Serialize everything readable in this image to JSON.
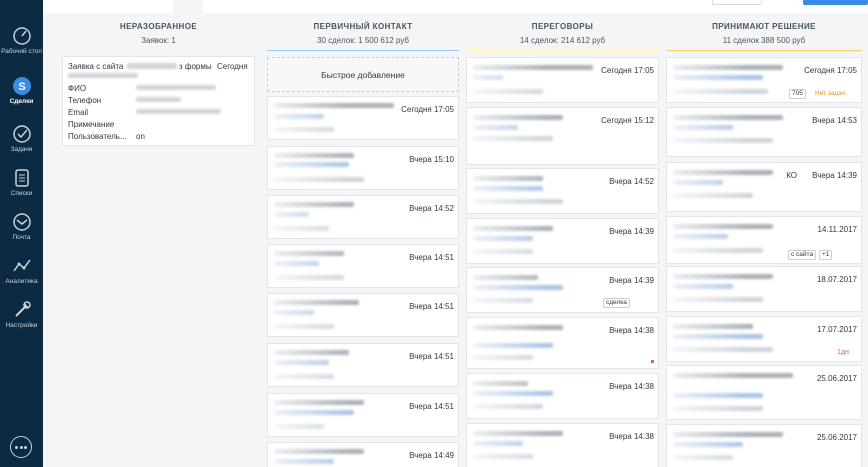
{
  "nav": {
    "items": [
      {
        "label": "Рабочий стол",
        "icon": "dashboard-icon"
      },
      {
        "label": "Сделки",
        "icon": "deals-icon",
        "active": true
      },
      {
        "label": "Задачи",
        "icon": "tasks-icon"
      },
      {
        "label": "Списки",
        "icon": "lists-icon"
      },
      {
        "label": "Почта",
        "icon": "mail-icon"
      },
      {
        "label": "Аналитика",
        "icon": "analytics-icon"
      },
      {
        "label": "Настройки",
        "icon": "settings-icon"
      }
    ],
    "chat_icon": "chat-icon",
    "colors": {
      "background": "#0c2a41",
      "active": "#ffffff"
    }
  },
  "columns": [
    {
      "title": "НЕРАЗОБРАННОЕ",
      "count": "Заявок: 1",
      "accent": "#b4bac0"
    },
    {
      "title": "ПЕРВИЧНЫЙ КОНТАКТ",
      "count": "30 сделок: 1 500 612 руб",
      "accent": "#99ccff"
    },
    {
      "title": "ПЕРЕГОВОРЫ",
      "count": "14 сделок: 214 612 руб",
      "accent": "#fff59d"
    },
    {
      "title": "ПРИНИМАЮТ РЕШЕНИЕ",
      "count": "11 сделок 388 500 руб",
      "accent": "#ffcc66"
    }
  ],
  "lead": {
    "header_left": "Заявка с сайта",
    "header_mid": "з формы",
    "header_date": "Сегодня",
    "rows": [
      {
        "label": "ФИО",
        "value": ""
      },
      {
        "label": "Телефон",
        "value": ""
      },
      {
        "label": "Email",
        "value": ""
      },
      {
        "label": "Примечание",
        "value": ""
      },
      {
        "label": "Пользователь...",
        "value": "on"
      }
    ]
  },
  "quick_add_label": "Быстрое добавление",
  "col1_dates": [
    "Сегодня 17:05",
    "Вчера 15:10",
    "Вчера 14:52",
    "Вчера 14:51",
    "Вчера 14:51",
    "Вчера 14:51",
    "Вчера 14:51",
    "Вчера 14:49"
  ],
  "col2_dates": [
    "Сегодня 17:05",
    "Сегодня 15:12",
    "Вчера 14:52",
    "Вчера 14:39",
    "Вчера 14:39",
    "Вчера 14:38",
    "Вчера 14:38",
    "Вчера 14:38"
  ],
  "col2_chip": "сделка",
  "col3_dates": [
    "Сегодня 17:05",
    "Вчера 14:53",
    "Вчера 14:39",
    "14.11.2017",
    "18.07.2017",
    "17.07.2017",
    "25.06.2017",
    "25.06.2017"
  ],
  "col3_extra": {
    "chip_705": "705",
    "no_tasks": "Нет задач",
    "partial_ko": "КО",
    "chip_site": "с сайта",
    "chip_plus1": "+1",
    "overdue": "1дн"
  },
  "accent_colors": {
    "link": "#3b8ae6",
    "warning": "#e88e1a",
    "danger": "#e35d6a"
  }
}
